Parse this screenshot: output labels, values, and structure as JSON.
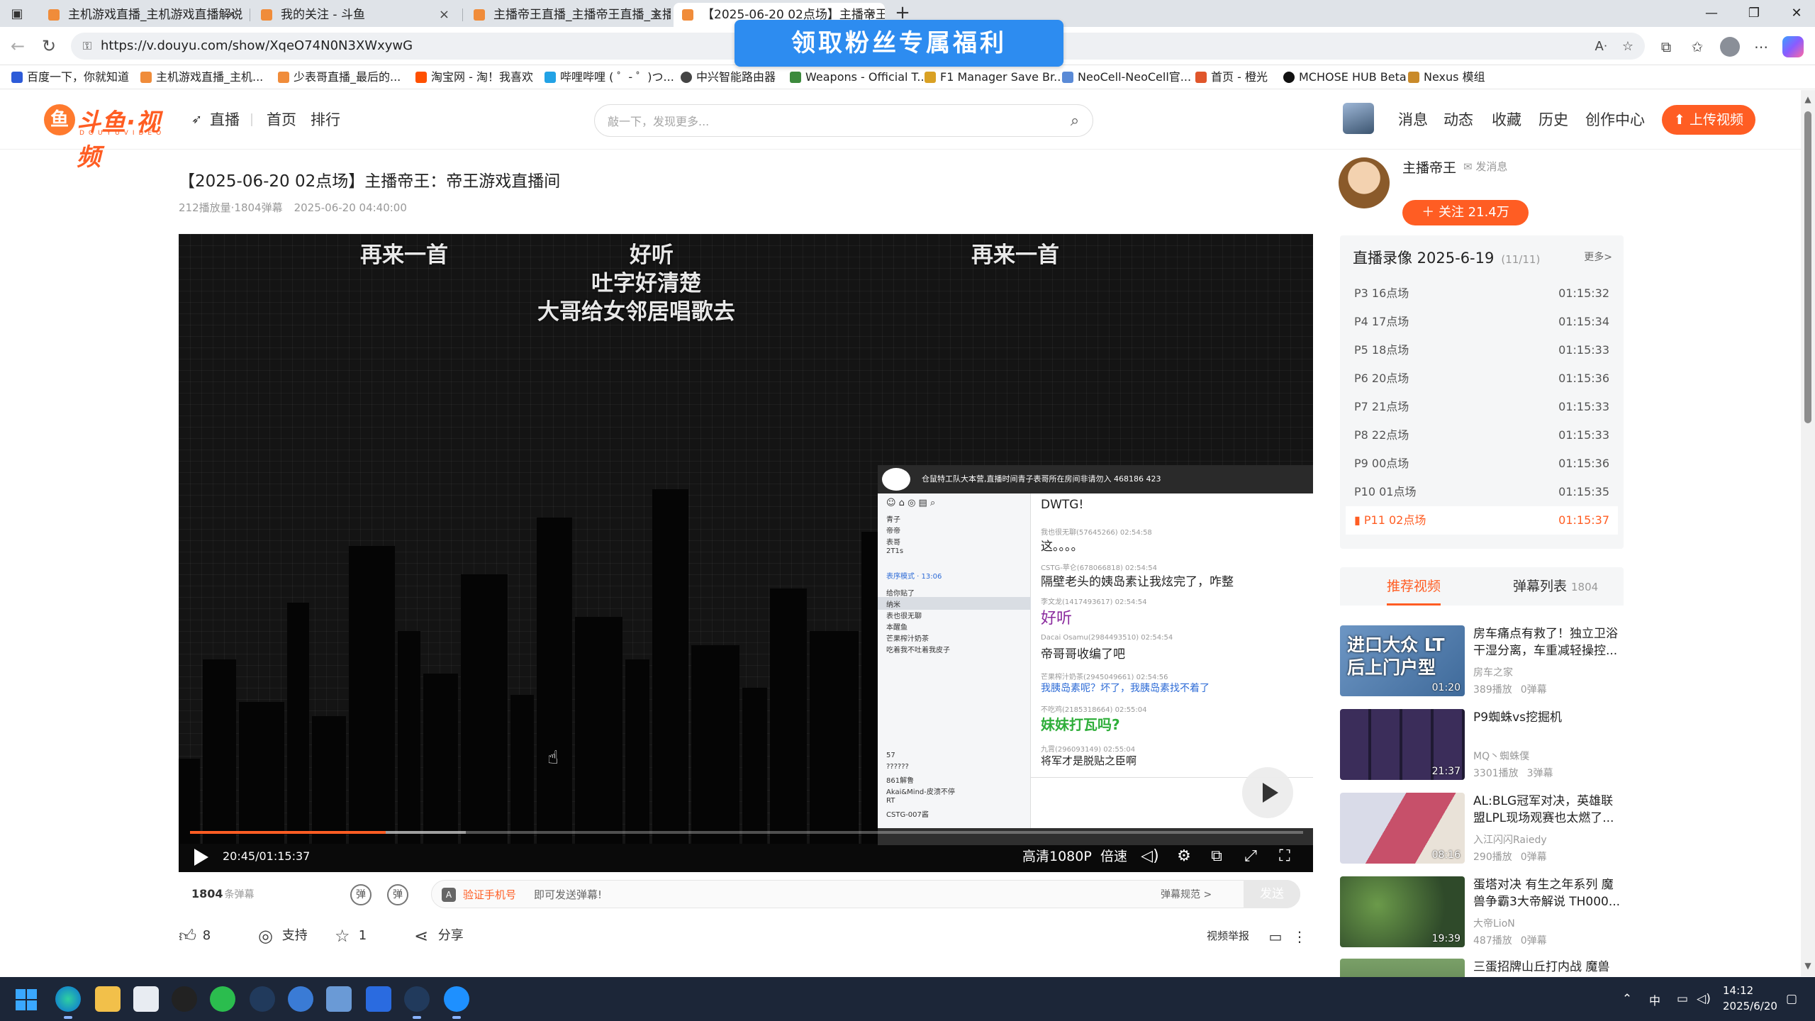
{
  "browser": {
    "tabs": [
      {
        "label": "主机游戏直播_主机游戏直播解说",
        "active": false
      },
      {
        "label": "我的关注 - 斗鱼",
        "active": false
      },
      {
        "label": "主播帝王直播_主播帝王直播_主播",
        "active": false
      },
      {
        "label": "【2025-06-20 02点场】主播帝王",
        "active": true
      }
    ],
    "url": "https://v.douyu.com/show/XqeO74N0N3XWxywG",
    "bookmarks": [
      "百度一下，你就知道",
      "主机游戏直播_主机...",
      "少表哥直播_最后的...",
      "淘宝网 - 淘！我喜欢",
      "哔哩哔哩 ( ゜- ゜)つ...",
      "中兴智能路由器",
      "Weapons - Official T...",
      "F1 Manager Save Br...",
      "NeoCell-NeoCell官...",
      "首页 - 橙光",
      "MCHOSE HUB Beta",
      "Nexus 模组"
    ],
    "promo_banner": "领取粉丝专属福利"
  },
  "header": {
    "logo_text": "斗鱼·视频",
    "logo_sub": "DOUYUVIDEO",
    "nav": [
      "直播",
      "首页",
      "排行"
    ],
    "search_placeholder": "敲一下，发现更多...",
    "links": [
      "消息",
      "动态",
      "收藏",
      "历史",
      "创作中心"
    ],
    "upload_label": "上传视频"
  },
  "video": {
    "title": "【2025-06-20 02点场】主播帝王：帝王游戏直播间",
    "views": "212播放量·1804弹幕",
    "date": "2025-06-20 04:40:00",
    "danmaku": [
      "再来一首",
      "好听",
      "吐字好清楚",
      "大哥给女邻居唱歌去",
      "再来一首"
    ],
    "chat_overlay": {
      "header": "仓鼠特工队大本营,直播时间青子表哥所在房间非请勿入  468186  423",
      "left_list": [
        "青子",
        "帝帝",
        "表哥",
        "2T1s",
        "表序模式 · 13:06",
        "给你贴了",
        "纳米",
        "表也很无聊",
        "本醒鱼",
        "芒果榨汁奶茶",
        "吃着我不吐着我皮子",
        "57",
        "??????",
        "861解鲁",
        "Akai&Mind-皮溃不停",
        "RT",
        "CSTG-007酱"
      ],
      "messages": [
        {
          "user": "",
          "text": "DWTG!"
        },
        {
          "user": "我也很无聊(57645266) 02:54:58",
          "text": "这。。。。"
        },
        {
          "user": "CSTG-苹仑(678066818) 02:54:54",
          "text": "隔壁老头的姨岛素让我炫完了，咋整"
        },
        {
          "user": "李文龙(1417493617) 02:54:54",
          "text": "好听"
        },
        {
          "user": "Dacai Osamu(2984493510) 02:54:54",
          "text": "帝哥哥收编了吧"
        },
        {
          "user": "芒果榨汁奶茶(2945049661) 02:54:56",
          "text": "我胰岛素呢？坏了，我胰岛素找不着了"
        },
        {
          "user": "不吃鸡(2185318664) 02:55:04",
          "text": "妹妹打瓦吗?"
        },
        {
          "user": "九霄(296093149) 02:55:04",
          "text": "将军才是脱贴之臣啊"
        }
      ]
    },
    "controls": {
      "time": "20:45/01:15:37",
      "progress": 0.176,
      "buffered": 0.248,
      "quality": "高清1080P",
      "speed": "倍速"
    }
  },
  "danmaku_bar": {
    "count": "1804",
    "count_unit": "条弹幕",
    "verify_link": "验证手机号",
    "hint": "即可发送弹幕!",
    "rule_link": "弹幕规范 >",
    "send_label": "发送"
  },
  "actions": {
    "like_count": "8",
    "support_label": "支持",
    "fav_count": "1",
    "share_label": "分享",
    "report_label": "视频举报"
  },
  "streamer": {
    "name": "主播帝王",
    "message_label": "发消息",
    "follow_label": "关注 21.4万"
  },
  "playlist": {
    "title": "直播录像 2025-6-19",
    "count": "(11/11)",
    "more": "更多>",
    "items": [
      {
        "name": "P3 16点场",
        "duration": "01:15:32",
        "active": false
      },
      {
        "name": "P4 17点场",
        "duration": "01:15:34",
        "active": false
      },
      {
        "name": "P5 18点场",
        "duration": "01:15:33",
        "active": false
      },
      {
        "name": "P6 20点场",
        "duration": "01:15:36",
        "active": false
      },
      {
        "name": "P7 21点场",
        "duration": "01:15:33",
        "active": false
      },
      {
        "name": "P8 22点场",
        "duration": "01:15:33",
        "active": false
      },
      {
        "name": "P9 00点场",
        "duration": "01:15:36",
        "active": false
      },
      {
        "name": "P10 01点场",
        "duration": "01:15:35",
        "active": false
      },
      {
        "name": "P11 02点场",
        "duration": "01:15:37",
        "active": true
      }
    ]
  },
  "side_tabs": {
    "recommend": "推荐视频",
    "danmaku_list": "弹幕列表",
    "danmaku_count": "1804"
  },
  "recommendations": [
    {
      "title": "房车痛点有救了！独立卫浴干湿分离，车重减轻操控...",
      "author": "房车之家",
      "plays": "389播放",
      "danmaku": "0弹幕",
      "duration": "01:20",
      "thumb_text": "进口大众 LT后上门户型",
      "thumb_color": "#5f86b3"
    },
    {
      "title": "P9蜘蛛vs挖掘机",
      "author": "MQ丶蜘蛛僕",
      "plays": "3301播放",
      "danmaku": "3弹幕",
      "duration": "21:37",
      "thumb_text": "",
      "thumb_color": "#2a2440"
    },
    {
      "title": "AL:BLG冠军对决，英雄联盟LPL现场观赛也太燃了...",
      "author": "入江闪闪Raiedy",
      "plays": "290播放",
      "danmaku": "0弹幕",
      "duration": "08:16",
      "thumb_text": "",
      "thumb_color": "#c7506a"
    },
    {
      "title": "蛋塔对决 有生之年系列 魔兽争霸3大帝解说 TH000...",
      "author": "大帝LioN",
      "plays": "487播放",
      "danmaku": "0弹幕",
      "duration": "19:39",
      "thumb_text": "",
      "thumb_color": "#3f6a3a"
    },
    {
      "title": "三蛋招牌山丘打内战 魔兽",
      "author": "",
      "plays": "",
      "danmaku": "",
      "duration": "",
      "thumb_text": "",
      "thumb_color": "#5a7a50"
    }
  ],
  "taskbar": {
    "ime": "中",
    "time": "14:12",
    "date": "2025/6/20"
  },
  "colors": {
    "accent": "#ff5d23",
    "promo_blue": "#2d8cf0",
    "taskbar": "#1c2638"
  }
}
